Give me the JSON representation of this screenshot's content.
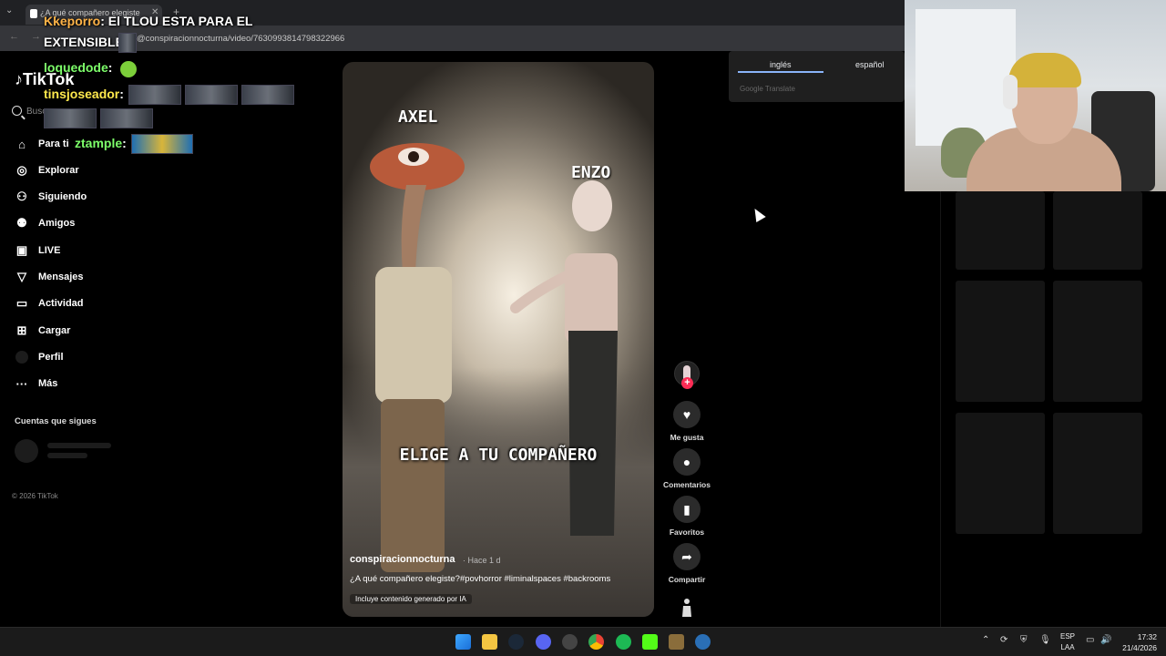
{
  "browser": {
    "tab_title": "¿A qué compañero elegiste",
    "url": "@conspiracionnocturna/video/7630993814798322966"
  },
  "chat": [
    {
      "user": "Kkeporro",
      "sep": ":",
      "message": "El TLOU ESTA PARA EL"
    },
    {
      "message": "EXTENSIBLE"
    },
    {
      "user": "loquedode",
      "sep": ":"
    },
    {
      "user": "tinsjoseador",
      "sep": ":"
    },
    {
      "user": "ztample",
      "sep": ":"
    }
  ],
  "tiktok": {
    "logo": "TikTok",
    "search_placeholder": "Busc",
    "nav": [
      {
        "label": "Para ti",
        "icon": "home-icon"
      },
      {
        "label": "Explorar",
        "icon": "compass-icon"
      },
      {
        "label": "Siguiendo",
        "icon": "person-icon"
      },
      {
        "label": "Amigos",
        "icon": "friends-icon"
      },
      {
        "label": "LIVE",
        "icon": "live-icon"
      },
      {
        "label": "Mensajes",
        "icon": "send-icon"
      },
      {
        "label": "Actividad",
        "icon": "activity-icon"
      },
      {
        "label": "Cargar",
        "icon": "upload-icon"
      },
      {
        "label": "Perfil",
        "icon": "profile-icon"
      },
      {
        "label": "Más",
        "icon": "more-icon"
      }
    ],
    "following_title": "Cuentas que sigues",
    "copyright": "© 2026 TikTok"
  },
  "video": {
    "label_left": "AXEL",
    "label_right": "ENZO",
    "caption": "ELIGE A TU COMPAÑERO",
    "creator": "conspiracionnocturna",
    "date": "· Hace 1 d",
    "description": "¿A qué compañero elegiste?#povhorror #liminalspaces #backrooms",
    "ai_note": "Incluye contenido generado por IA"
  },
  "actions": {
    "like": "Me gusta",
    "comments": "Comentarios",
    "favorites": "Favoritos",
    "share": "Compartir"
  },
  "translate": {
    "tab_1": "inglés",
    "tab_2": "español",
    "brand": "Google Translate"
  },
  "taskbar": {
    "lang_1": "ESP",
    "lang_2": "LAA",
    "time": "17:32",
    "date": "21/4/2026"
  },
  "colors": {
    "accent": "#fe2c55",
    "translate_accent": "#8ab4f8"
  }
}
